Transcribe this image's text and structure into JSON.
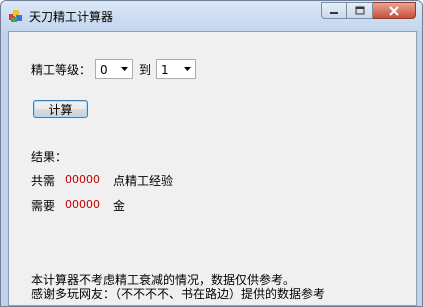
{
  "window": {
    "title": "天刀精工计算器"
  },
  "form": {
    "level_label": "精工等级：",
    "from_value": "0",
    "to_label": "到",
    "to_value": "1",
    "calc_button": "计算"
  },
  "results": {
    "header": "结果：",
    "exp_prefix": "共需",
    "exp_value": "00000",
    "exp_suffix": "点精工经验",
    "gold_prefix": "需要",
    "gold_value": "00000",
    "gold_suffix": "金"
  },
  "footer": {
    "note_line1": "本计算器不考虑精工衰减的情况，数据仅供参考。",
    "note_line2": "感谢多玩网友：（不不不不、书在路边）提供的数据参考"
  },
  "colors": {
    "value_red": "#c00000"
  }
}
